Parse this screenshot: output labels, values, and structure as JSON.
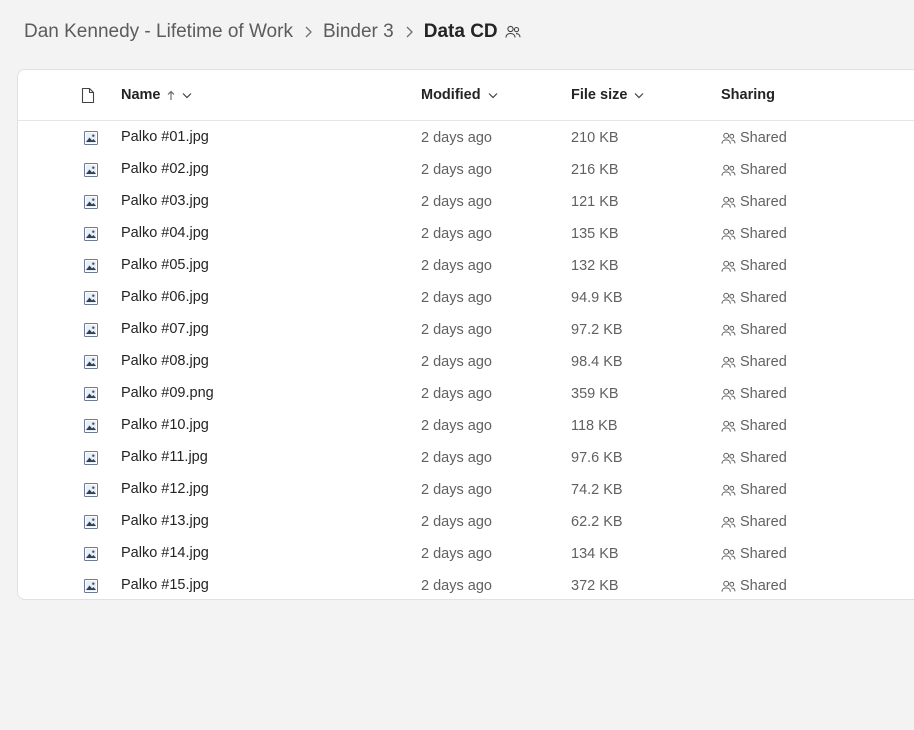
{
  "breadcrumb": {
    "items": [
      "Dan Kennedy - Lifetime of Work",
      "Binder 3"
    ],
    "current": "Data CD"
  },
  "columns": {
    "name": "Name",
    "modified": "Modified",
    "file_size": "File size",
    "sharing": "Sharing"
  },
  "files": [
    {
      "name": "Palko #01.jpg",
      "modified": "2 days ago",
      "size": "210 KB",
      "sharing": "Shared"
    },
    {
      "name": "Palko #02.jpg",
      "modified": "2 days ago",
      "size": "216 KB",
      "sharing": "Shared"
    },
    {
      "name": "Palko #03.jpg",
      "modified": "2 days ago",
      "size": "121 KB",
      "sharing": "Shared"
    },
    {
      "name": "Palko #04.jpg",
      "modified": "2 days ago",
      "size": "135 KB",
      "sharing": "Shared"
    },
    {
      "name": "Palko #05.jpg",
      "modified": "2 days ago",
      "size": "132 KB",
      "sharing": "Shared"
    },
    {
      "name": "Palko #06.jpg",
      "modified": "2 days ago",
      "size": "94.9 KB",
      "sharing": "Shared"
    },
    {
      "name": "Palko #07.jpg",
      "modified": "2 days ago",
      "size": "97.2 KB",
      "sharing": "Shared"
    },
    {
      "name": "Palko #08.jpg",
      "modified": "2 days ago",
      "size": "98.4 KB",
      "sharing": "Shared"
    },
    {
      "name": "Palko #09.png",
      "modified": "2 days ago",
      "size": "359 KB",
      "sharing": "Shared"
    },
    {
      "name": "Palko #10.jpg",
      "modified": "2 days ago",
      "size": "118 KB",
      "sharing": "Shared"
    },
    {
      "name": "Palko #11.jpg",
      "modified": "2 days ago",
      "size": "97.6 KB",
      "sharing": "Shared"
    },
    {
      "name": "Palko #12.jpg",
      "modified": "2 days ago",
      "size": "74.2 KB",
      "sharing": "Shared"
    },
    {
      "name": "Palko #13.jpg",
      "modified": "2 days ago",
      "size": "62.2 KB",
      "sharing": "Shared"
    },
    {
      "name": "Palko #14.jpg",
      "modified": "2 days ago",
      "size": "134 KB",
      "sharing": "Shared"
    },
    {
      "name": "Palko #15.jpg",
      "modified": "2 days ago",
      "size": "372 KB",
      "sharing": "Shared"
    }
  ]
}
